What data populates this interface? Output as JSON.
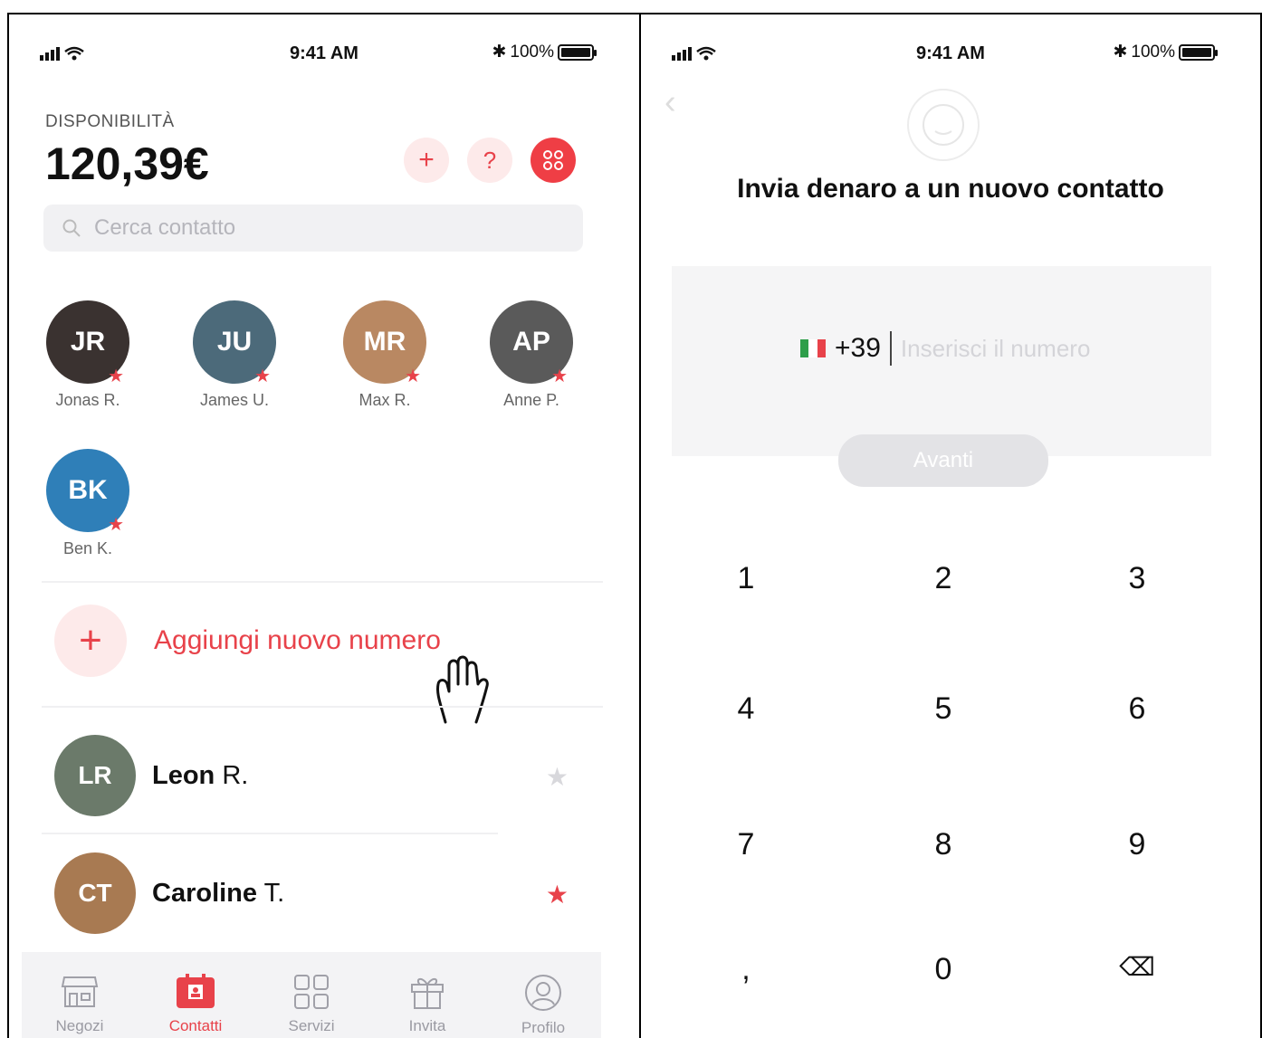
{
  "left": {
    "status": {
      "time": "9:41 AM",
      "battery": "100%"
    },
    "balance_label": "DISPONIBILITÀ",
    "balance": "120,39€",
    "header_buttons": {
      "add": "+",
      "help": "?",
      "apps": "88"
    },
    "search": {
      "placeholder": "Cerca contatto"
    },
    "favorites": [
      {
        "name": "Jonas R.",
        "initials": "JR",
        "color": "#3a3230"
      },
      {
        "name": "James U.",
        "initials": "JU",
        "color": "#4c6a7a"
      },
      {
        "name": "Max R.",
        "initials": "MR",
        "color": "#b98862"
      },
      {
        "name": "Anne P.",
        "initials": "AP",
        "color": "#5a5a5a"
      },
      {
        "name": "Ben K.",
        "initials": "BK",
        "color": "#2f7fb8"
      }
    ],
    "add_number_label": "Aggiungi nuovo numero",
    "contacts": [
      {
        "first": "Leon",
        "last": " R.",
        "initials": "LR",
        "color": "#6b7a6a",
        "starred": false
      },
      {
        "first": "Caroline",
        "last": " T.",
        "initials": "CT",
        "color": "#a87a52",
        "starred": true
      }
    ],
    "tabs": [
      {
        "label": "Negozi",
        "icon": "store-icon",
        "active": false
      },
      {
        "label": "Contatti",
        "icon": "contacts-icon",
        "active": true
      },
      {
        "label": "Servizi",
        "icon": "grid-icon",
        "active": false
      },
      {
        "label": "Invita",
        "icon": "gift-icon",
        "active": false
      },
      {
        "label": "Profilo",
        "icon": "profile-icon",
        "active": false
      }
    ]
  },
  "right": {
    "status": {
      "time": "9:41 AM",
      "battery": "100%"
    },
    "title": "Invia denaro a un nuovo contatto",
    "prefix": "+39",
    "number_placeholder": "Inserisci il numero",
    "next_label": "Avanti",
    "keypad": [
      "1",
      "2",
      "3",
      "4",
      "5",
      "6",
      "7",
      "8",
      "9",
      ",",
      "0",
      "⌫"
    ]
  },
  "colors": {
    "accent": "#e8424a",
    "accent_light": "#fdeaea",
    "muted": "#9a9aa2"
  }
}
